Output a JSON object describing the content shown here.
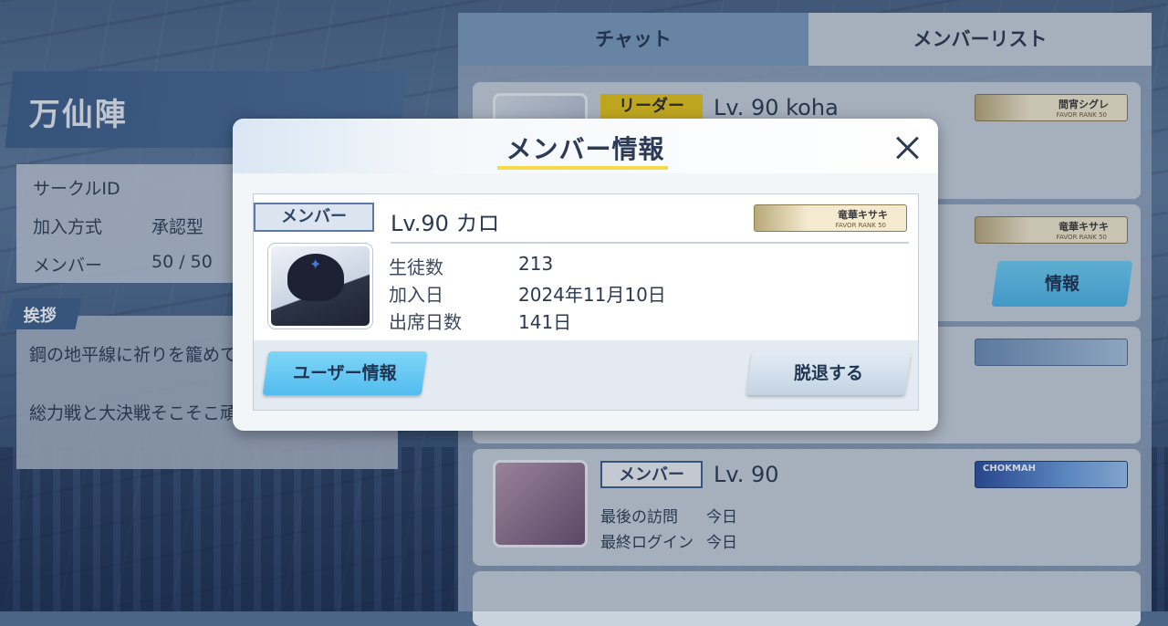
{
  "circle": {
    "name": "万仙陣",
    "info": [
      {
        "label": "サークルID",
        "value": ""
      },
      {
        "label": "加入方式",
        "value": "承認型"
      },
      {
        "label": "メンバー",
        "value": "50 / 50"
      }
    ],
    "greeting_tag": "挨拶",
    "greeting_lines": [
      "鋼の地平線に祈りを籠めて",
      "総力戦と大決戦そこそこ頑"
    ]
  },
  "tabs": {
    "chat": "チャット",
    "member_list": "メンバーリスト"
  },
  "member_list": [
    {
      "badge": "リーダー",
      "level": "Lv. 90 koha",
      "char_tag": "間宵シグレ",
      "rank_text": "FAVOR RANK 50"
    },
    {
      "badge": "",
      "level": "",
      "char_tag": "竜華キサキ",
      "rank_text": "FAVOR RANK 50",
      "info_button": "情報"
    },
    {
      "badge": "",
      "level": "",
      "char_tag": ""
    },
    {
      "badge": "メンバー",
      "level": "Lv. 90",
      "char_tag": "CHOKMAH",
      "last_visit_label": "最後の訪問",
      "last_visit_value": "今日",
      "last_login_label": "最終ログイン",
      "last_login_value": "今日"
    }
  ],
  "modal": {
    "title": "メンバー情報",
    "badge": "メンバー",
    "level_name": "Lv.90 カロ",
    "char_tag": "竜華キサキ",
    "rank_text": "FAVOR RANK 50",
    "stats": [
      {
        "label": "生徒数",
        "value": "213"
      },
      {
        "label": "加入日",
        "value": "2024年11月10日"
      },
      {
        "label": "出席日数",
        "value": "141日"
      }
    ],
    "user_info_button": "ユーザー情報",
    "leave_button": "脱退する"
  },
  "colors": {
    "accent_blue": "#52bcee",
    "leader_yellow": "#e8c61a",
    "title_underline": "#f4d94a"
  }
}
